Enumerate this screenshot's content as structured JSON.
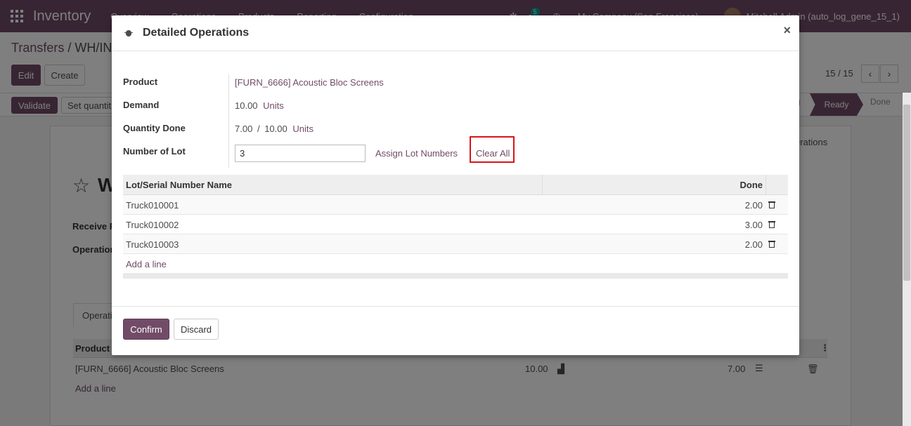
{
  "navbar": {
    "app_name": "Inventory",
    "menu": [
      "Overview",
      "Operations",
      "Products",
      "Reporting",
      "Configuration"
    ],
    "messages_count": "5",
    "company": "My Company (San Francisco)",
    "user": "Mitchell Admin (auto_log_gene_15_1)"
  },
  "control_panel": {
    "breadcrumb_root": "Transfers",
    "breadcrumb_sep": "/",
    "breadcrumb_current": "WH/IN/",
    "edit_label": "Edit",
    "create_label": "Create",
    "pager": "15 / 15",
    "validate_label": "Validate",
    "set_quantities_label": "Set quantiti",
    "status_waiting": "g",
    "status_ready": "Ready",
    "status_done": "Done"
  },
  "background": {
    "star_title": "W",
    "receive_label": "Receive F",
    "operation_label": "Operation",
    "tab_operations": "Operati",
    "tab_detailed": "erations",
    "product_header": "Product",
    "row_product": "[FURN_6666] Acoustic Bloc Screens",
    "row_demand": "10.00",
    "row_done": "7.00",
    "add_line": "Add a line"
  },
  "modal": {
    "title": "Detailed Operations",
    "close": "×",
    "fields": {
      "product_label": "Product",
      "product_value": "[FURN_6666] Acoustic Bloc Screens",
      "demand_label": "Demand",
      "demand_value": "10.00",
      "demand_unit": "Units",
      "qty_done_label": "Quantity Done",
      "qty_done_value": "7.00",
      "qty_done_sep": "/",
      "qty_done_total": "10.00",
      "qty_done_unit": "Units",
      "lot_label": "Number of Lot",
      "lot_value": "3",
      "assign_label": "Assign Lot Numbers",
      "clear_label": "Clear All"
    },
    "table": {
      "col_name": "Lot/Serial Number Name",
      "col_done": "Done",
      "rows": [
        {
          "name": "Truck010001",
          "done": "2.00"
        },
        {
          "name": "Truck010002",
          "done": "3.00"
        },
        {
          "name": "Truck010003",
          "done": "2.00"
        }
      ],
      "add_line": "Add a line"
    },
    "footer": {
      "confirm": "Confirm",
      "discard": "Discard"
    }
  }
}
